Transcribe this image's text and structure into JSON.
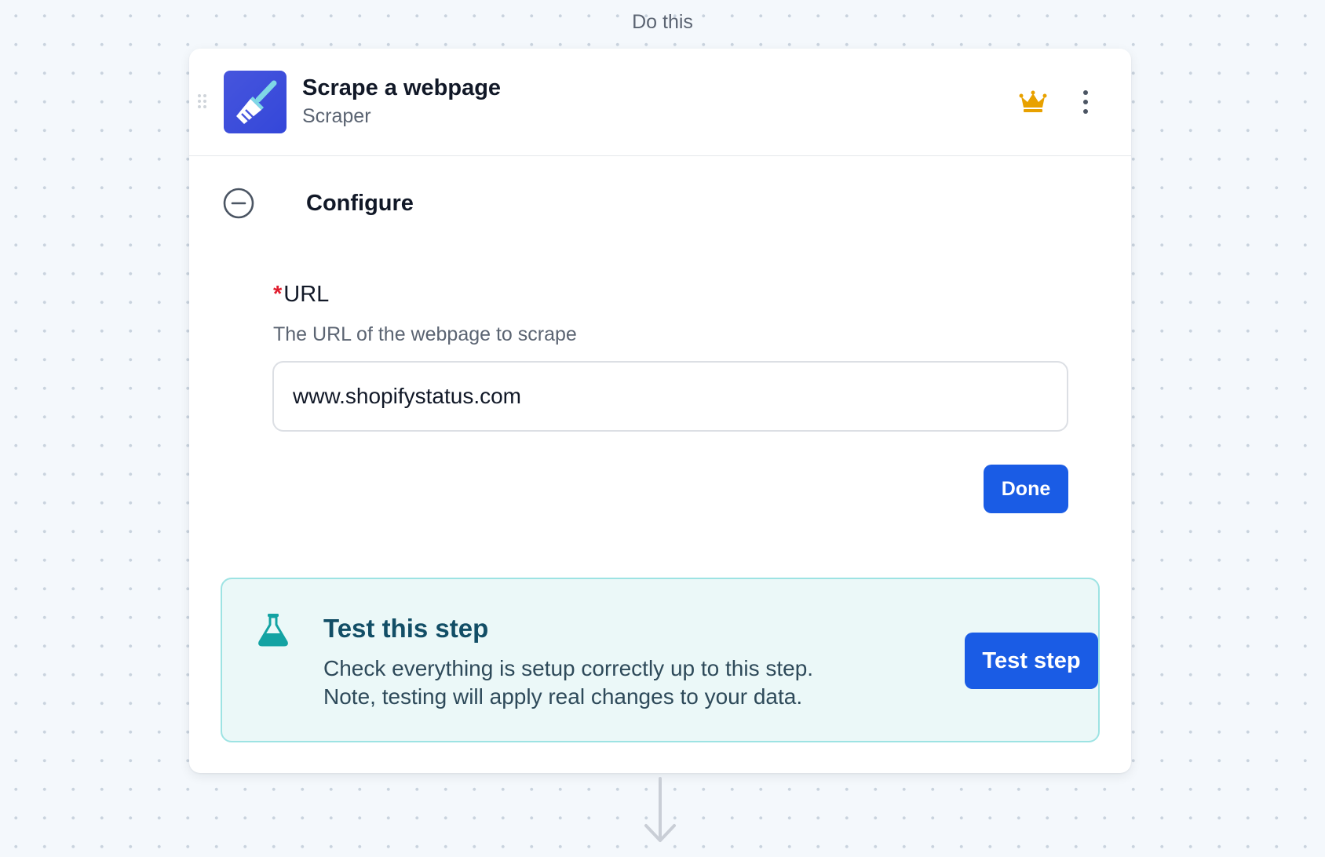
{
  "section": {
    "label": "Do this"
  },
  "step": {
    "title": "Scrape a webpage",
    "subtitle": "Scraper",
    "app_icon": "broom-icon",
    "premium_icon": "crown-icon",
    "menu_icon": "more-vertical-icon"
  },
  "configure": {
    "label": "Configure",
    "collapse_icon": "minus-circle-icon",
    "field": {
      "required_marker": "*",
      "label": "URL",
      "help": "The URL of the webpage to scrape",
      "value": "www.shopifystatus.com"
    },
    "done_label": "Done"
  },
  "test": {
    "icon": "flask-icon",
    "title": "Test this step",
    "description_line1": "Check everything is setup correctly up to this step.",
    "description_line2": "Note, testing will apply real changes to your data.",
    "button_label": "Test step"
  },
  "colors": {
    "primary": "#1a5ce5",
    "premium": "#e8a100",
    "test_panel_bg": "#ebf8f8",
    "test_panel_border": "#9de3e3",
    "required": "#e11d2e"
  }
}
